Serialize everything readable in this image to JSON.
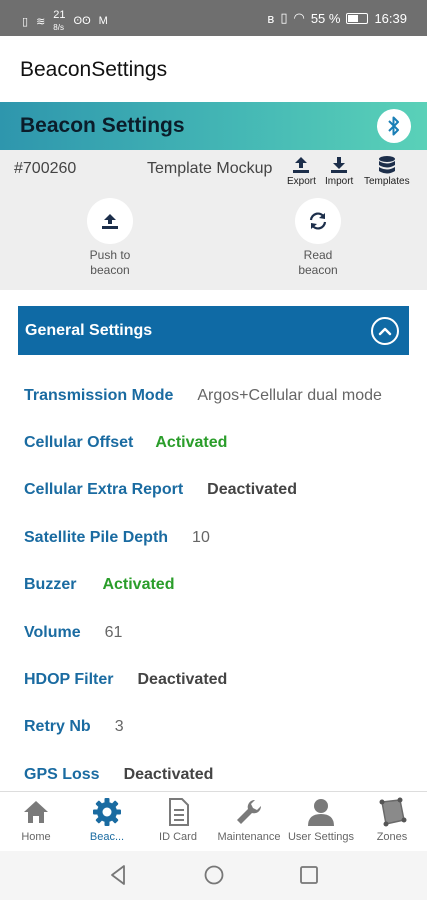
{
  "status_bar": {
    "left_text": "21",
    "left_sub": "8/s",
    "battery_percent": "55 %",
    "time": "16:39"
  },
  "app_bar": {
    "title": "BeaconSettings"
  },
  "banner": {
    "title": "Beacon Settings",
    "icon": "bluetooth-icon"
  },
  "toolbar": {
    "beacon_id": "#700260",
    "template_name": "Template Mockup",
    "export_label": "Export",
    "import_label": "Import",
    "templates_label": "Templates",
    "push_label_1": "Push to",
    "push_label_2": "beacon",
    "read_label_1": "Read",
    "read_label_2": "beacon"
  },
  "section": {
    "title": "General Settings"
  },
  "settings": [
    {
      "label": "Transmission Mode",
      "value": "Argos+Cellular dual mode"
    },
    {
      "label": "Cellular Offset",
      "value": "Activated"
    },
    {
      "label": "Cellular Extra Report",
      "value": "Deactivated"
    },
    {
      "label": "Satellite Pile Depth",
      "value": "10"
    },
    {
      "label": "Buzzer",
      "value": "Activated"
    },
    {
      "label": "Volume",
      "value": "61"
    },
    {
      "label": "HDOP Filter",
      "value": "Deactivated"
    },
    {
      "label": "Retry Nb",
      "value": "3"
    },
    {
      "label": "GPS Loss",
      "value": "Deactivated"
    }
  ],
  "bottom_nav": {
    "home": "Home",
    "beacon": "Beac...",
    "id_card": "ID Card",
    "maintenance": "Maintenance",
    "user_settings": "User Settings",
    "zones": "Zones"
  },
  "colors": {
    "primary_blue": "#0f6aa5",
    "activated_green": "#2a9d2a",
    "banner_gradient_start": "#2e96ad",
    "banner_gradient_end": "#5ad1b8"
  }
}
